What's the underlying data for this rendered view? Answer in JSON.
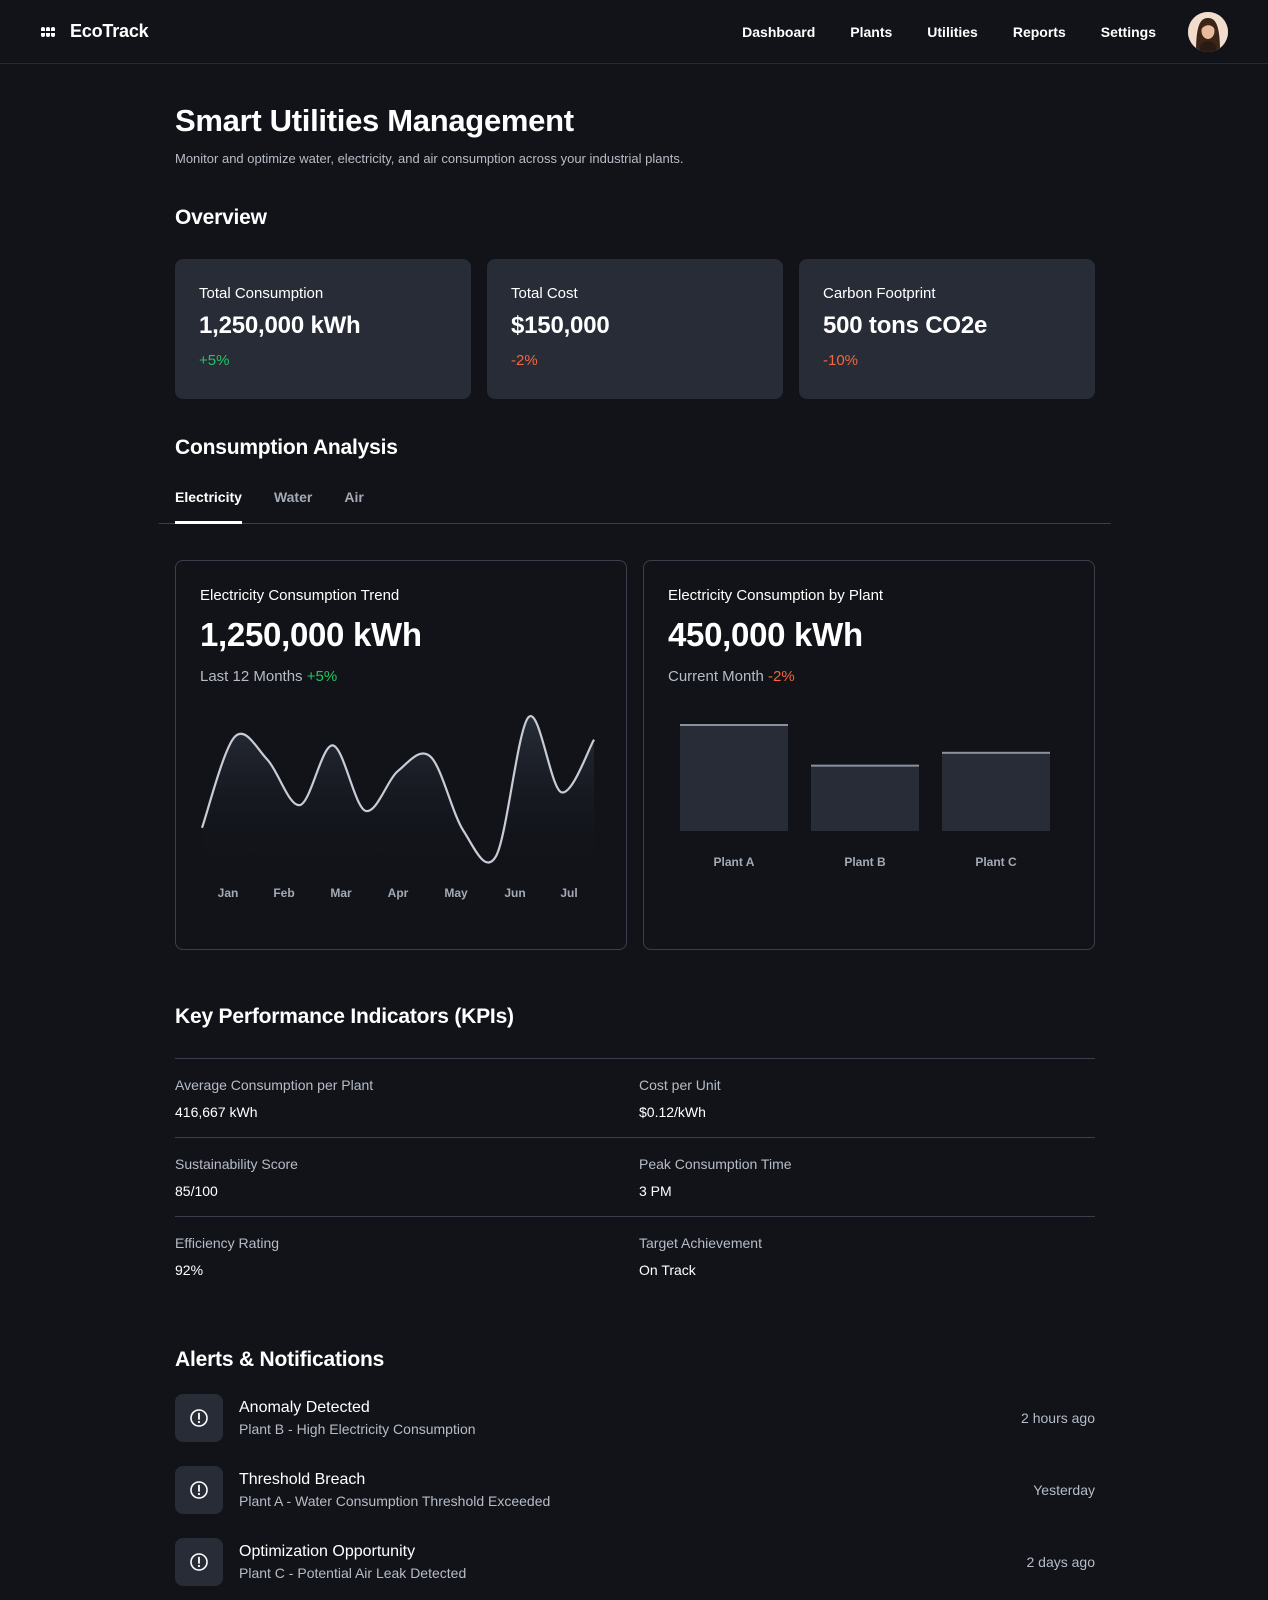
{
  "header": {
    "brand": "EcoTrack",
    "brand_icon": "eco-logo-icon",
    "nav": [
      "Dashboard",
      "Plants",
      "Utilities",
      "Reports",
      "Settings"
    ]
  },
  "page": {
    "title": "Smart Utilities Management",
    "subtitle": "Monitor and optimize water, electricity, and air consumption across your industrial plants."
  },
  "overview": {
    "title": "Overview",
    "cards": [
      {
        "label": "Total Consumption",
        "value": "1,250,000 kWh",
        "change": "+5%"
      },
      {
        "label": "Total Cost",
        "value": "$150,000",
        "change": "-2%"
      },
      {
        "label": "Carbon Footprint",
        "value": "500 tons CO2e",
        "change": "-10%"
      }
    ]
  },
  "analysis": {
    "title": "Consumption Analysis",
    "tabs": [
      "Electricity",
      "Water",
      "Air"
    ],
    "active_tab": "Electricity",
    "trend": {
      "label": "Electricity Consumption Trend",
      "value": "1,250,000 kWh",
      "period": "Last 12 Months",
      "change": "+5%"
    },
    "by_plant": {
      "label": "Electricity Consumption by Plant",
      "value": "450,000 kWh",
      "period": "Current Month",
      "change": "-2%"
    }
  },
  "chart_data": [
    {
      "type": "line",
      "categories": [
        "Jan",
        "Feb",
        "Mar",
        "Apr",
        "May",
        "Jun",
        "Jul"
      ],
      "x": [
        0,
        0.5,
        1,
        1.5,
        2,
        2.5,
        3,
        3.5,
        4,
        4.5,
        5,
        5.5,
        6
      ],
      "values": [
        0.22,
        0.86,
        0.7,
        0.38,
        0.8,
        0.34,
        0.62,
        0.72,
        0.2,
        0.02,
        1.0,
        0.47,
        0.84
      ],
      "ylim": [
        0,
        1
      ],
      "grid": false,
      "legend": "none"
    },
    {
      "type": "bar",
      "categories": [
        "Plant A",
        "Plant B",
        "Plant C"
      ],
      "values": [
        1.0,
        0.62,
        0.74
      ],
      "ylim": [
        0,
        1
      ],
      "grid": false
    }
  ],
  "kpis": {
    "title": "Key Performance Indicators (KPIs)",
    "rows": [
      [
        {
          "label": "Average Consumption per Plant",
          "value": "416,667 kWh"
        },
        {
          "label": "Cost per Unit",
          "value": "$0.12/kWh"
        }
      ],
      [
        {
          "label": "Sustainability Score",
          "value": "85/100"
        },
        {
          "label": "Peak Consumption Time",
          "value": "3 PM"
        }
      ],
      [
        {
          "label": "Efficiency Rating",
          "value": "92%"
        },
        {
          "label": "Target Achievement",
          "value": "On Track"
        }
      ]
    ]
  },
  "alerts": {
    "title": "Alerts & Notifications",
    "icon": "alert-circle-icon",
    "items": [
      {
        "title": "Anomaly Detected",
        "desc": "Plant B - High Electricity Consumption",
        "time": "2 hours ago"
      },
      {
        "title": "Threshold Breach",
        "desc": "Plant A - Water Consumption Threshold Exceeded",
        "time": "Yesterday"
      },
      {
        "title": "Optimization Opportunity",
        "desc": "Plant C - Potential Air Leak Detected",
        "time": "2 days ago"
      }
    ]
  },
  "colors": {
    "background": "#111319",
    "card": "#272c37",
    "positive": "#22c55e",
    "negative": "#f4663d",
    "line": "#c7ccd6"
  }
}
